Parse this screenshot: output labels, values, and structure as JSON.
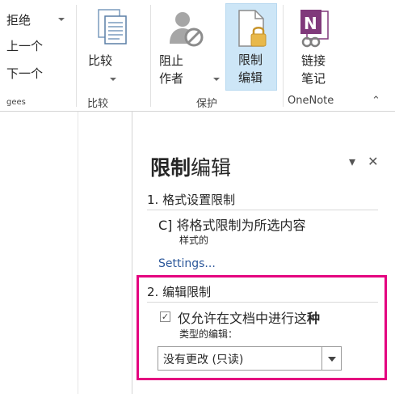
{
  "ribbon": {
    "review": {
      "reject": "拒绝",
      "previous": "上一个",
      "next": "下一个",
      "group_label": "gees"
    },
    "compare": {
      "button": "比较",
      "group_label": "比较"
    },
    "protect": {
      "block_authors_line1": "阻止",
      "block_authors_line2": "作者",
      "restrict_editing_line1": "限制",
      "restrict_editing_line2": "编辑",
      "group_label": "保护"
    },
    "onenote": {
      "linked_notes_line1": "链接",
      "linked_notes_line2": "笔记",
      "group_label": "OneNote"
    },
    "collapse_glyph": "⌃"
  },
  "pane": {
    "title_bold": "限制",
    "title_rest": "编辑",
    "dropdown_glyph": "▾",
    "close_glyph": "✕",
    "section1": {
      "heading": "1. 格式设置限制",
      "checkbox_glyph": "C]",
      "checkbox_label": "将格式限制为所选内容",
      "checkbox_sublabel": "样式的",
      "settings_link": "Settings..."
    },
    "section2": {
      "heading": "2. 编辑限制",
      "checkbox_mark": "✓",
      "checkbox_label_a": "仅允许在文档中进行这",
      "checkbox_label_b": "种",
      "checkbox_sublabel": "类型的编辑：",
      "dropdown_value": "没有更改 (只读)"
    }
  },
  "colors": {
    "accent": "#2b579a",
    "highlight": "#cde6f7",
    "callout": "#e4007f"
  }
}
